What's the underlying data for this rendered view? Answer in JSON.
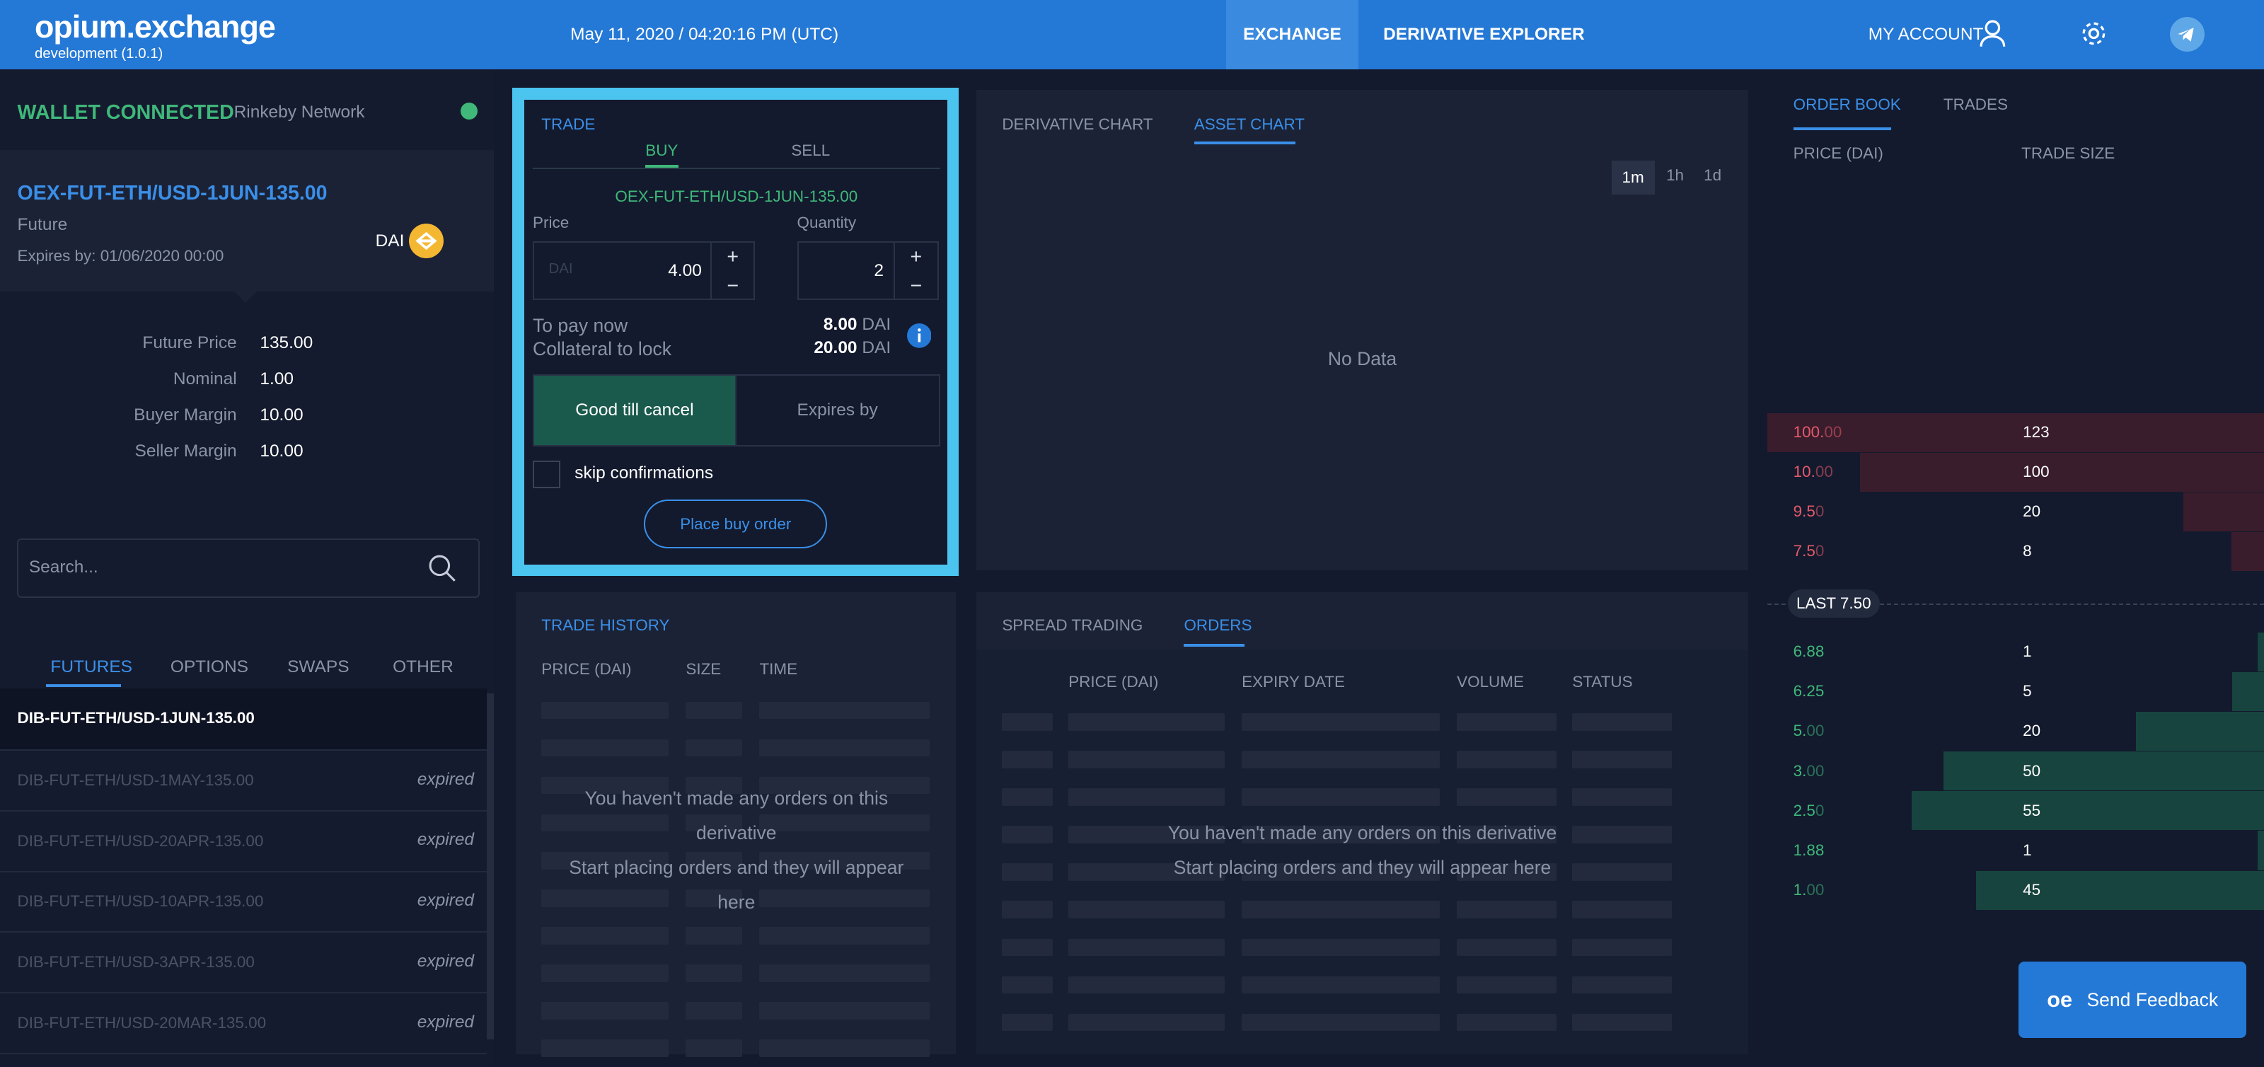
{
  "header": {
    "logo": "opium.exchange",
    "version": "development (1.0.1)",
    "datetime": "May 11, 2020 / 04:20:16 PM (UTC)",
    "nav_exchange": "EXCHANGE",
    "nav_explorer": "DERIVATIVE EXPLORER",
    "my_account": "MY ACCOUNT"
  },
  "wallet": {
    "status": "WALLET CONNECTED",
    "network": "Rinkeby Network",
    "status_color": "#3fb87a"
  },
  "instrument": {
    "ticker": "OEX-FUT-ETH/USD-1JUN-135.00",
    "kind": "Future",
    "expires": "Expires by: 01/06/2020 00:00",
    "currency": "DAI",
    "details": [
      {
        "label": "Future Price",
        "value": "135.00"
      },
      {
        "label": "Nominal",
        "value": "1.00"
      },
      {
        "label": "Buyer Margin",
        "value": "10.00"
      },
      {
        "label": "Seller Margin",
        "value": "10.00"
      }
    ]
  },
  "search": {
    "placeholder": "Search..."
  },
  "market_tabs": [
    "FUTURES",
    "OPTIONS",
    "SWAPS",
    "OTHER"
  ],
  "market_list": [
    {
      "name": "DIB-FUT-ETH/USD-1JUN-135.00",
      "status": ""
    },
    {
      "name": "DIB-FUT-ETH/USD-1MAY-135.00",
      "status": "expired"
    },
    {
      "name": "DIB-FUT-ETH/USD-20APR-135.00",
      "status": "expired"
    },
    {
      "name": "DIB-FUT-ETH/USD-10APR-135.00",
      "status": "expired"
    },
    {
      "name": "DIB-FUT-ETH/USD-3APR-135.00",
      "status": "expired"
    },
    {
      "name": "DIB-FUT-ETH/USD-20MAR-135.00",
      "status": "expired"
    }
  ],
  "trade": {
    "title": "TRADE",
    "tab_buy": "BUY",
    "tab_sell": "SELL",
    "ticker": "OEX-FUT-ETH/USD-1JUN-135.00",
    "price_label": "Price",
    "quantity_label": "Quantity",
    "price_unit": "DAI",
    "price_value": "4.00",
    "quantity_value": "2",
    "to_pay_label": "To pay now",
    "to_pay_value": "8.00",
    "collateral_label": "Collateral to lock",
    "collateral_value": "20.00",
    "unit": "DAI",
    "gtc": "Good till cancel",
    "expires_by": "Expires by",
    "skip": "skip confirmations",
    "place": "Place buy order"
  },
  "chart": {
    "tab1": "DERIVATIVE CHART",
    "tab2": "ASSET CHART",
    "tf": [
      "1m",
      "1h",
      "1d"
    ],
    "no_data": "No Data"
  },
  "trade_history": {
    "title": "TRADE HISTORY",
    "headers": [
      "PRICE (DAI)",
      "SIZE",
      "TIME"
    ],
    "empty1": "You haven't made any orders on this derivative",
    "empty2": "Start placing orders and they will appear here"
  },
  "orders": {
    "tab1": "SPREAD TRADING",
    "tab2": "ORDERS",
    "headers": [
      "PRICE (DAI)",
      "EXPIRY DATE",
      "VOLUME",
      "STATUS"
    ],
    "empty1": "You haven't made any orders on this derivative",
    "empty2": "Start placing orders and they will appear here"
  },
  "order_book": {
    "tab1": "ORDER BOOK",
    "tab2": "TRADES",
    "header_price": "PRICE (DAI)",
    "header_size": "TRADE SIZE",
    "asks": [
      {
        "p1": "100.",
        "p2": "00",
        "size": "123"
      },
      {
        "p1": "10.",
        "p2": "00",
        "size": "100"
      },
      {
        "p1": "9.5",
        "p2": "0",
        "size": "20"
      },
      {
        "p1": "7.5",
        "p2": "0",
        "size": "8"
      }
    ],
    "last": "LAST 7.50",
    "bids": [
      {
        "p1": "6.88",
        "p2": "",
        "size": "1"
      },
      {
        "p1": "6.25",
        "p2": "",
        "size": "5"
      },
      {
        "p1": "5.",
        "p2": "00",
        "size": "20"
      },
      {
        "p1": "3.",
        "p2": "00",
        "size": "50"
      },
      {
        "p1": "2.5",
        "p2": "0",
        "size": "55"
      },
      {
        "p1": "1.88",
        "p2": "",
        "size": "1"
      },
      {
        "p1": "1.",
        "p2": "00",
        "size": "45"
      }
    ],
    "ask_color": "#e55a6a",
    "bid_color": "#3fb87a"
  },
  "feedback": {
    "label": "Send Feedback",
    "logo": "oe"
  }
}
